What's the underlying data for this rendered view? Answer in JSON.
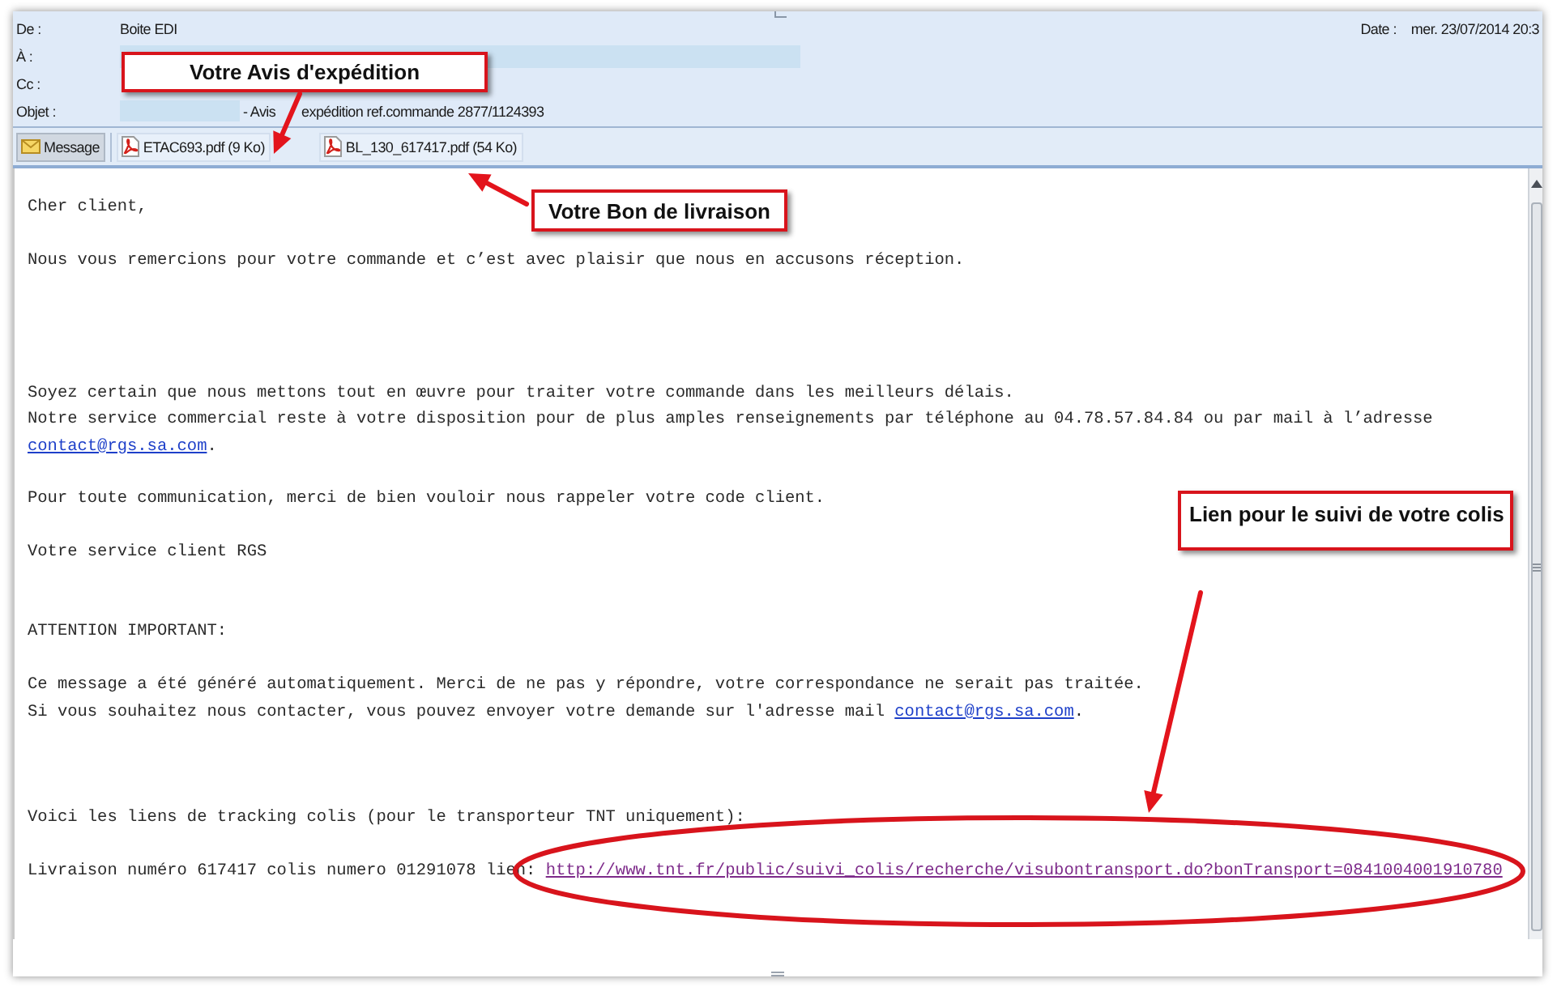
{
  "header": {
    "fields": [
      {
        "label": "De :",
        "kind": "text",
        "value": "Boite EDI"
      },
      {
        "label": "À :",
        "kind": "redacted"
      },
      {
        "label": "Cc :",
        "kind": "text"
      },
      {
        "label": "Objet :",
        "kind": "partly_redacted",
        "values": [
          "- Avis",
          "expédition ref.commande 2877/1124393"
        ]
      }
    ],
    "date": {
      "label": "Date :",
      "value": "mer. 23/07/2014 20:3"
    }
  },
  "attachments": [
    {
      "kind": "message",
      "label": "Message",
      "selected": true
    },
    {
      "kind": "pdf",
      "label": "ETAC693.pdf (9 Ko)",
      "selected": false
    },
    {
      "kind": "pdf",
      "label": "BL_130_617417.pdf (54 Ko)",
      "selected": false
    }
  ],
  "body": {
    "paragraphs": [
      {
        "lines": [
          [
            {
              "kind": "text",
              "text": "Cher client,"
            }
          ]
        ]
      },
      {
        "lines": [
          [
            {
              "kind": "text",
              "text": "Nous vous remercions pour votre commande et c’est avec plaisir que nous en accusons réception."
            }
          ]
        ]
      },
      {
        "lines": [
          [
            {
              "kind": "text",
              "text": "Soyez certain que nous mettons tout en œuvre pour traiter votre commande dans les meilleurs délais."
            }
          ],
          [
            {
              "kind": "text",
              "text": "Notre service commercial reste à votre disposition pour de plus amples renseignements par téléphone au 04.78.57.84.84 ou par mail à l’adresse"
            }
          ],
          [
            {
              "kind": "link",
              "text": "contact@rgs.sa.com",
              "visited": false
            },
            {
              "kind": "text",
              "text": "."
            }
          ]
        ]
      },
      {
        "lines": [
          [
            {
              "kind": "text",
              "text": "Pour toute communication, merci de bien vouloir nous rappeler votre code client."
            }
          ]
        ]
      },
      {
        "lines": [
          [
            {
              "kind": "text",
              "text": "Votre service client RGS"
            }
          ]
        ]
      },
      {
        "lines": [
          [
            {
              "kind": "text",
              "text": "ATTENTION IMPORTANT:"
            }
          ]
        ]
      },
      {
        "lines": [
          [
            {
              "kind": "text",
              "text": "Ce message a été généré automatiquement. Merci de ne pas y répondre, votre correspondance ne serait pas traitée."
            }
          ],
          [
            {
              "kind": "text",
              "text": "Si vous souhaitez nous contacter, vous pouvez envoyer votre demande sur l'adresse mail "
            },
            {
              "kind": "link",
              "text": "contact@rgs.sa.com",
              "visited": false
            },
            {
              "kind": "text",
              "text": "."
            }
          ]
        ]
      },
      {
        "lines": [
          [
            {
              "kind": "text",
              "text": "Voici les liens de tracking colis (pour le transporteur TNT uniquement):"
            }
          ]
        ]
      },
      {
        "lines": [
          [
            {
              "kind": "text",
              "text": "Livraison numéro 617417 colis numero 01291078 lien: "
            },
            {
              "kind": "link",
              "text": "http://www.tnt.fr/public/suivi_colis/recherche/visubontransport.do?bonTransport=0841004001910780",
              "visited": true
            }
          ]
        ]
      }
    ]
  },
  "annotations": [
    {
      "text": "Votre Avis d'expédition"
    },
    {
      "text": "Votre Bon de livraison"
    },
    {
      "text": "Lien pour le suivi de votre colis"
    }
  ]
}
